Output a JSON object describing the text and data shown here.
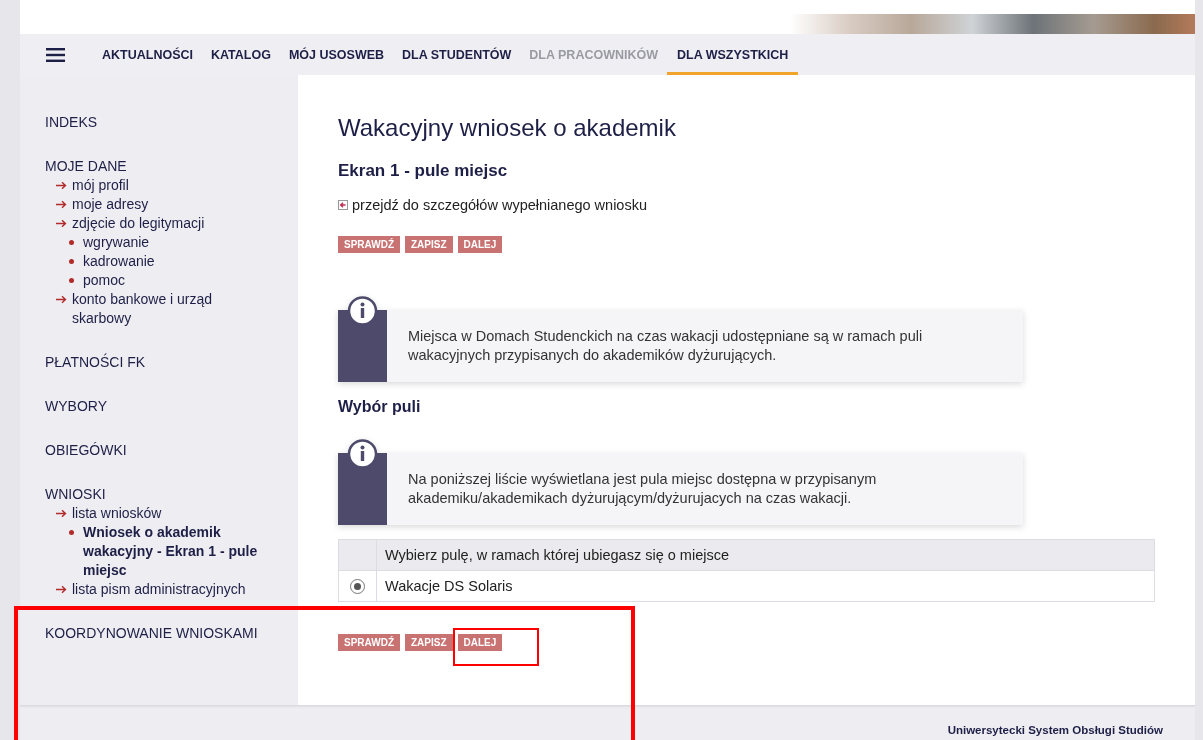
{
  "nav": {
    "items": [
      {
        "label": "AKTUALNOŚCI",
        "selected": false,
        "disabled": false
      },
      {
        "label": "KATALOG",
        "selected": false,
        "disabled": false
      },
      {
        "label": "MÓJ USOSWEB",
        "selected": false,
        "disabled": false
      },
      {
        "label": "DLA STUDENTÓW",
        "selected": false,
        "disabled": false
      },
      {
        "label": "DLA PRACOWNIKÓW",
        "selected": false,
        "disabled": true
      },
      {
        "label": "DLA WSZYSTKICH",
        "selected": true,
        "disabled": false
      }
    ]
  },
  "sidebar": {
    "sections": [
      {
        "label": "INDEKS"
      },
      {
        "label": "MOJE DANE",
        "children": [
          {
            "label": "mój profil",
            "selected": false
          },
          {
            "label": "moje adresy",
            "selected": false
          },
          {
            "label": "zdjęcie do legitymacji",
            "selected": false,
            "children": [
              {
                "label": "wgrywanie",
                "selected": false
              },
              {
                "label": "kadrowanie",
                "selected": false
              },
              {
                "label": "pomoc",
                "selected": false
              }
            ]
          },
          {
            "label": "konto bankowe i urząd skarbowy",
            "selected": false
          }
        ]
      },
      {
        "label": "PŁATNOŚCI FK"
      },
      {
        "label": "WYBORY"
      },
      {
        "label": "OBIEGÓWKI"
      },
      {
        "label": "WNIOSKI",
        "children": [
          {
            "label": "lista wniosków",
            "selected": false,
            "children": [
              {
                "label": "Wniosek o akademik wakacyjny - Ekran 1 - pule miejsc",
                "selected": true
              }
            ]
          },
          {
            "label": "lista pism administracyjnych",
            "selected": false
          }
        ]
      },
      {
        "label": "KOORDYNOWANIE WNIOSKAMI"
      }
    ]
  },
  "page": {
    "title": "Wakacyjny wniosek o akademik",
    "subtitle": "Ekran 1 - pule miejsc",
    "details_link": "przejdź do szczegółów wypełnianego wniosku",
    "buttons_top": [
      "SPRAWDŹ",
      "ZAPISZ",
      "DALEJ"
    ],
    "info_1": "Miejsca w Domach Studenckich na czas wakacji udostępniane są w ramach puli wakacyjnych przypisanych do akademików dyżurujących.",
    "section_heading": "Wybór puli",
    "info_2": "Na poniższej liście wyświetlana jest pula miejsc dostępna w przypisanym akademiku/akademikach dyżurującym/dyżurujacych na czas wakacji.",
    "table": {
      "header": "Wybierz pulę, w ramach której ubiegasz się o miejsce",
      "rows": [
        {
          "label": "Wakacje DS Solaris",
          "selected": true
        }
      ]
    },
    "buttons_bottom": [
      "SPRAWDŹ",
      "ZAPISZ",
      "DALEJ"
    ]
  },
  "footer": {
    "text": "Uniwersytecki System Obsługi Studiów"
  },
  "highlight_frames": {
    "around_sidebar_bottom": true,
    "around_dalej_button": true
  }
}
